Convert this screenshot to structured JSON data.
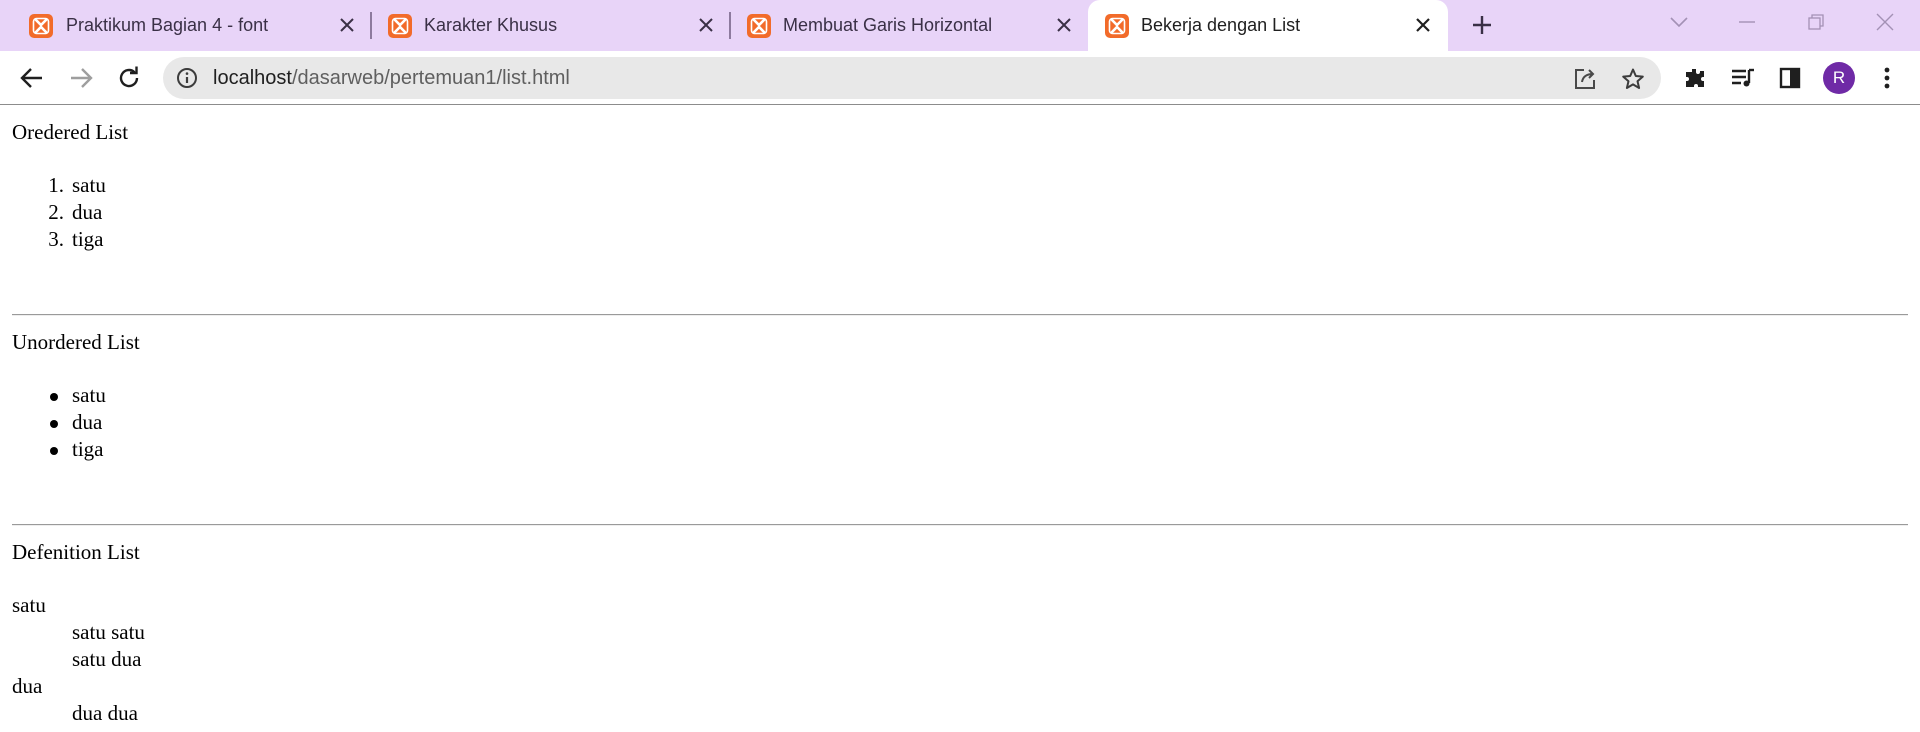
{
  "browser": {
    "tabs": [
      {
        "label": "Praktikum Bagian 4 - font",
        "favicon": "xampp-icon"
      },
      {
        "label": "Karakter Khusus",
        "favicon": "xampp-icon"
      },
      {
        "label": "Membuat Garis Horizontal",
        "favicon": "xampp-icon"
      },
      {
        "label": "Bekerja dengan List",
        "favicon": "xampp-icon",
        "active": true
      }
    ],
    "address": {
      "host": "localhost",
      "path": "/dasarweb/pertemuan1/list.html"
    },
    "profile_initial": "R",
    "colors": {
      "tabstrip": "#e8d4f8",
      "favicon": "#f26b2a",
      "avatar": "#6f2aa6"
    }
  },
  "page": {
    "ordered": {
      "heading": "Oredered List",
      "items": [
        "satu",
        "dua",
        "tiga"
      ],
      "markers": [
        "1.",
        "2.",
        "3."
      ]
    },
    "unordered": {
      "heading": "Unordered List",
      "items": [
        "satu",
        "dua",
        "tiga"
      ]
    },
    "definition": {
      "heading": "Defenition List",
      "entries": [
        {
          "term": "satu",
          "definitions": [
            "satu satu",
            "satu dua"
          ]
        },
        {
          "term": "dua",
          "definitions": [
            "dua dua"
          ]
        }
      ]
    }
  }
}
